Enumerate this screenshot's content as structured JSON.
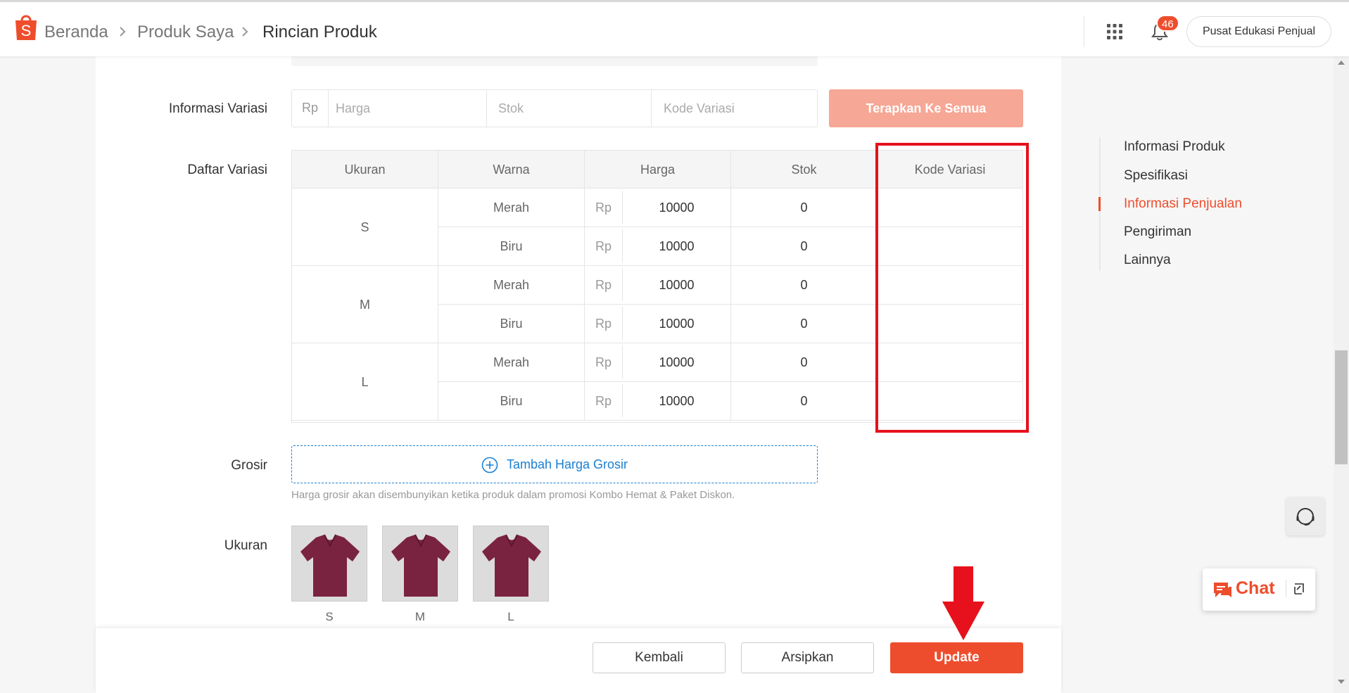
{
  "header": {
    "breadcrumbs": [
      "Beranda",
      "Produk Saya",
      "Rincian Produk"
    ],
    "notification_count": "46",
    "edu_button": "Pusat Edukasi Penjual"
  },
  "variation_info": {
    "label": "Informasi Variasi",
    "currency": "Rp",
    "price_placeholder": "Harga",
    "stock_placeholder": "Stok",
    "code_placeholder": "Kode Variasi",
    "apply_all_label": "Terapkan Ke Semua"
  },
  "variation_list": {
    "label": "Daftar Variasi",
    "columns": [
      "Ukuran",
      "Warna",
      "Harga",
      "Stok",
      "Kode Variasi"
    ],
    "currency": "Rp",
    "groups": [
      {
        "size": "S",
        "rows": [
          {
            "color": "Merah",
            "price": "10000",
            "stock": "0",
            "code": ""
          },
          {
            "color": "Biru",
            "price": "10000",
            "stock": "0",
            "code": ""
          }
        ]
      },
      {
        "size": "M",
        "rows": [
          {
            "color": "Merah",
            "price": "10000",
            "stock": "0",
            "code": ""
          },
          {
            "color": "Biru",
            "price": "10000",
            "stock": "0",
            "code": ""
          }
        ]
      },
      {
        "size": "L",
        "rows": [
          {
            "color": "Merah",
            "price": "10000",
            "stock": "0",
            "code": ""
          },
          {
            "color": "Biru",
            "price": "10000",
            "stock": "0",
            "code": ""
          }
        ]
      }
    ]
  },
  "wholesale": {
    "label": "Grosir",
    "add_button": "Tambah Harga Grosir",
    "hint": "Harga grosir akan disembunyikan ketika produk dalam promosi Kombo Hemat & Paket Diskon."
  },
  "size_images": {
    "label": "Ukuran",
    "items": [
      "S",
      "M",
      "L"
    ]
  },
  "side_nav": {
    "items": [
      "Informasi Produk",
      "Spesifikasi",
      "Informasi Penjualan",
      "Pengiriman",
      "Lainnya"
    ],
    "active_index": 2
  },
  "actions": {
    "back": "Kembali",
    "archive": "Arsipkan",
    "update": "Update"
  },
  "chat": {
    "label": "Chat"
  },
  "colors": {
    "brand": "#ee4d2d",
    "apply_disabled": "#f6a795",
    "link_blue": "#1a7fd1",
    "highlight_red": "#e6111c",
    "shirt": "#7a2340"
  }
}
